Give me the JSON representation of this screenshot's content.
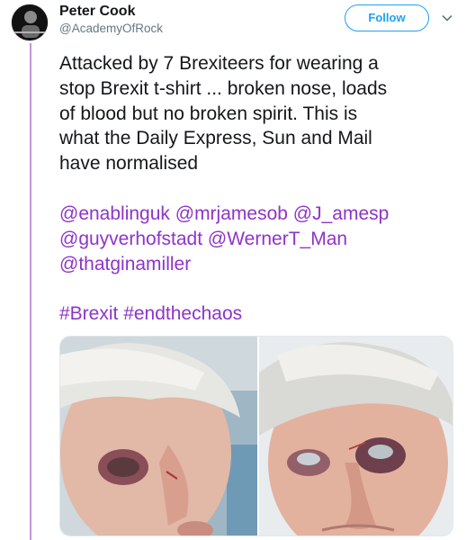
{
  "author": {
    "name": "Peter Cook",
    "handle": "@AcademyOfRock",
    "avatar_icon": "user-avatar"
  },
  "actions": {
    "follow_label": "Follow",
    "menu_icon": "chevron-down-icon"
  },
  "tweet": {
    "text_line1": "Attacked by 7 Brexiteers for wearing a",
    "text_line2": "stop Brexit t-shirt ... broken nose, loads",
    "text_line3": "of blood but no broken spirit.  This is",
    "text_line4": "what the Daily Express, Sun and Mail",
    "text_line5": "have normalised",
    "mentions": [
      "@enablinguk",
      "@mrjamesob",
      "@J_amesp",
      "@guyverhofstadt",
      "@WernerT_Man",
      "@thatginamiller"
    ],
    "hashtags": [
      "#Brexit",
      "#endthechaos"
    ]
  },
  "colors": {
    "link": "#8e34c9",
    "follow_blue": "#1da1f2",
    "thread_line": "#c493e0"
  },
  "media": {
    "count": 2,
    "icon": "photo-icon"
  }
}
